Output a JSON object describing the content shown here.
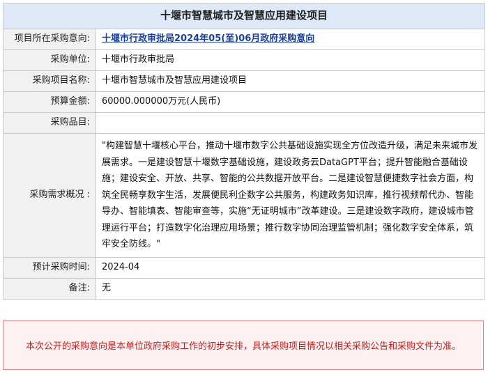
{
  "title": "十堰市智慧城市及智慧应用建设项目",
  "rows": [
    {
      "label": "项目所在采购意向:",
      "value": "十堰市行政审批局2024年05(至)06月政府采购意向"
    },
    {
      "label": "采购单位:",
      "value": "十堰市行政审批局"
    },
    {
      "label": "采购项目名称:",
      "value": "十堰市智慧城市及智慧应用建设项目"
    },
    {
      "label": "预算金额:",
      "value": "60000.000000万元(人民币)"
    },
    {
      "label": "采购品目:",
      "value": ""
    },
    {
      "label": "采购需求概况 :",
      "value": "\"构建智慧十堰核心平台，推动十堰市数字公共基础设施实现全方位改造升级，满足未来城市发展需求。一是建设智慧十堰数字基础设施，建设政务云DataGPT平台；提升智能融合基础设施；建设安全、开放、共享、智能的公共数据开放平台。二是建设智慧便捷数字社会方面，构筑全民畅享数字生活，发展便民利企数字公共服务，构建政务知识库，推行视频帮代办、智能导办、智能填表、智能审查等，实施“无证明城市”改革建设。三是建设数字政府，建设城市管理运行平台；打造数字化治理应用场景；推行数字协同治理监管机制；强化数字安全体系，筑牢安全防线。\""
    },
    {
      "label": "预计采购时间:",
      "value": "2024-04"
    },
    {
      "label": "备注:",
      "value": "无"
    }
  ],
  "notice": "本次公开的采购意向是本单位政府采购工作的初步安排，具体采购项目情况以相关采购公告和采购文件为准。"
}
